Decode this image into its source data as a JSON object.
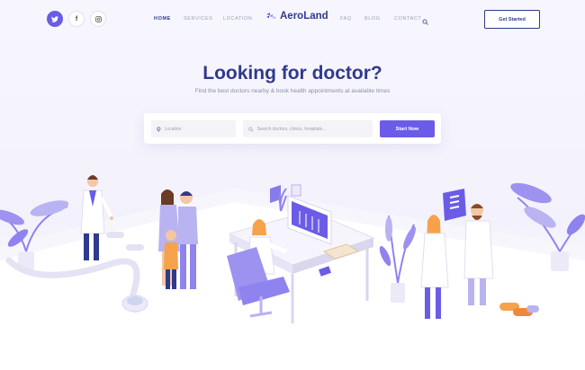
{
  "header": {
    "social": [
      {
        "name": "twitter",
        "icon": "twitter-icon"
      },
      {
        "name": "facebook",
        "icon": "facebook-icon",
        "glyph": "f"
      },
      {
        "name": "instagram",
        "icon": "instagram-icon"
      }
    ],
    "nav_left": [
      "HOME",
      "SERVICES",
      "LOCATION"
    ],
    "brand": "AeroLand",
    "nav_right": [
      "FAQ",
      "BLOG",
      "CONTACT"
    ],
    "cta": "Get Started"
  },
  "hero": {
    "title": "Looking for doctor?",
    "subtitle": "Find the best doctors nearby & book health appointments at available times"
  },
  "search": {
    "location_placeholder": "Location",
    "query_placeholder": "Search doctors, clinics, hospitals...",
    "submit_label": "Start Now"
  },
  "colors": {
    "accent": "#6b5ce7",
    "navy": "#2f3a8c",
    "lavender": "#b9b3f2"
  }
}
